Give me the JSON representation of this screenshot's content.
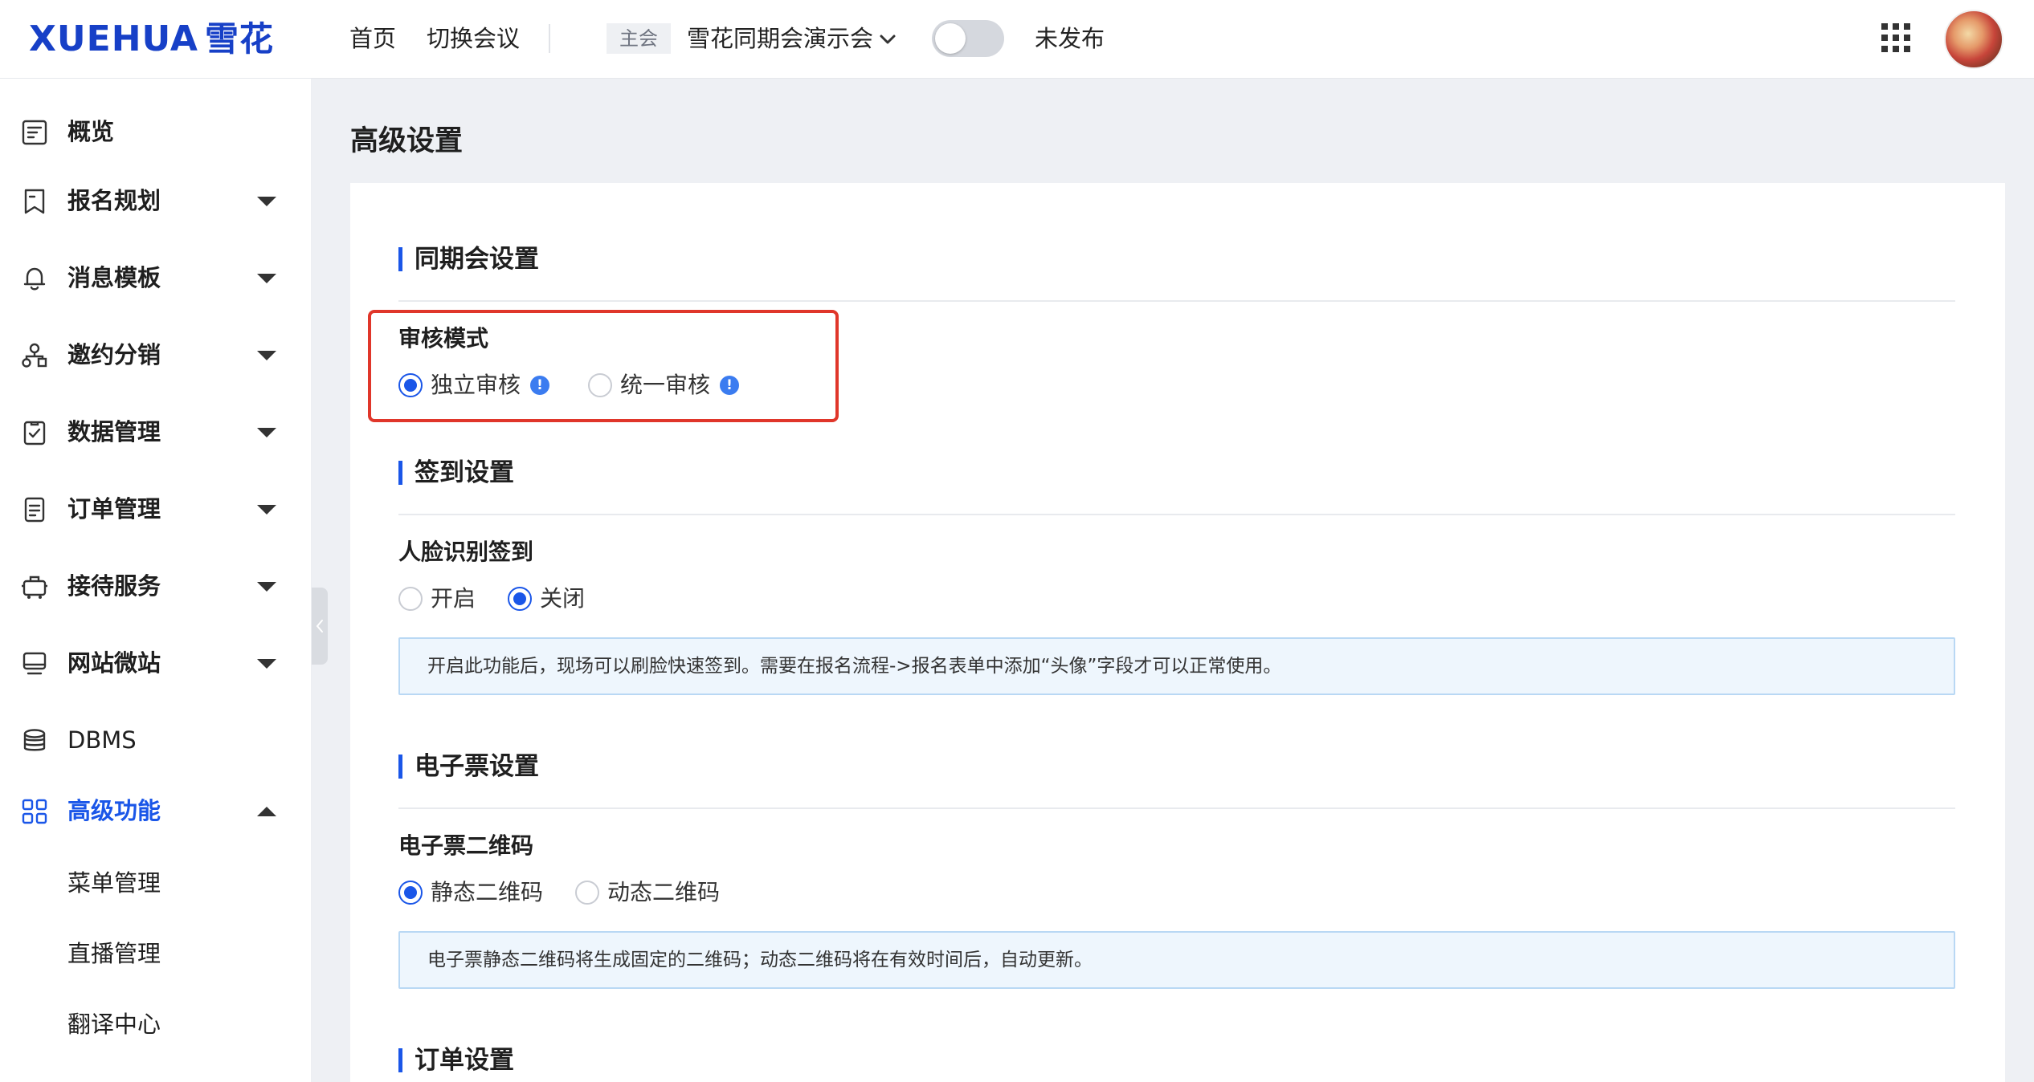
{
  "header": {
    "logo_latin": "XUEHUA",
    "logo_cn": "雪花",
    "nav": [
      "首页",
      "切换会议"
    ],
    "main_tag": "主会",
    "conference_name": "雪花同期会演示会",
    "publish_toggle_on": false,
    "publish_status": "未发布"
  },
  "sidebar": {
    "items": [
      {
        "label": "概览",
        "icon": "overview-icon"
      },
      {
        "label": "报名规划",
        "icon": "bookmark-icon"
      },
      {
        "label": "消息模板",
        "icon": "bell-icon"
      },
      {
        "label": "邀约分销",
        "icon": "org-tree-icon"
      },
      {
        "label": "数据管理",
        "icon": "clipboard-check-icon"
      },
      {
        "label": "订单管理",
        "icon": "document-icon"
      },
      {
        "label": "接待服务",
        "icon": "luggage-icon"
      },
      {
        "label": "网站微站",
        "icon": "monitor-icon"
      },
      {
        "label": "DBMS",
        "icon": "database-icon"
      },
      {
        "label": "高级功能",
        "icon": "grid-icon"
      }
    ],
    "subitems": [
      "菜单管理",
      "直播管理",
      "翻译中心"
    ],
    "accent_color": "#1a56e8"
  },
  "main": {
    "title": "高级设置",
    "sections": {
      "concurrent": {
        "title": "同期会设置",
        "field": "审核模式",
        "options": [
          "独立审核",
          "统一审核"
        ],
        "selected": "独立审核"
      },
      "checkin": {
        "title": "签到设置",
        "field": "人脸识别签到",
        "options": [
          "开启",
          "关闭"
        ],
        "selected": "关闭",
        "hint": "开启此功能后，现场可以刷脸快速签到。需要在报名流程->报名表单中添加“头像”字段才可以正常使用。"
      },
      "eticket": {
        "title": "电子票设置",
        "field": "电子票二维码",
        "options": [
          "静态二维码",
          "动态二维码"
        ],
        "selected": "静态二维码",
        "hint": "电子票静态二维码将生成固定的二维码；动态二维码将在有效时间后，自动更新。"
      },
      "order": {
        "title": "订单设置"
      }
    },
    "info_badge_symbol": "!"
  }
}
